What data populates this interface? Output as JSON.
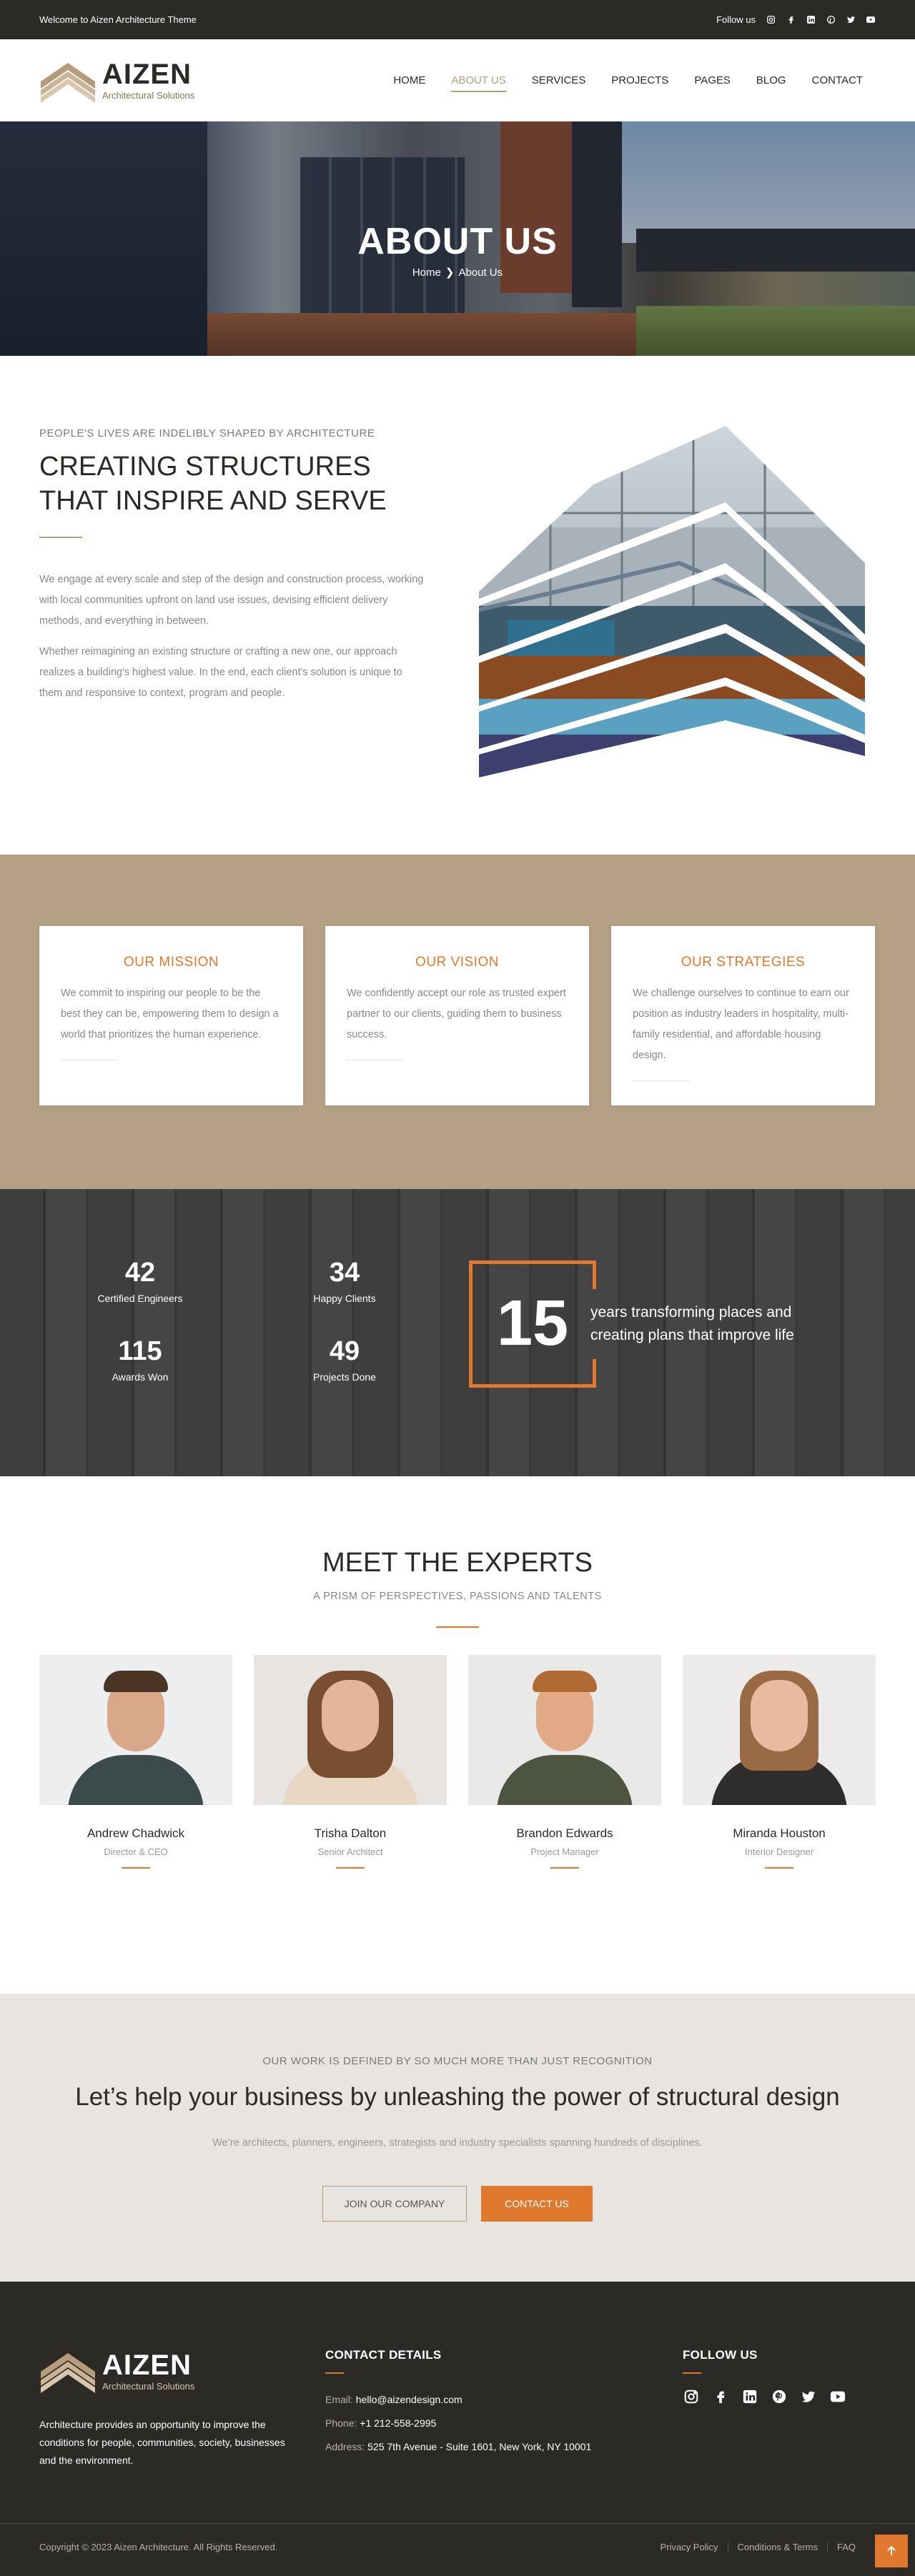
{
  "topbar": {
    "welcome": "Welcome to Aizen Architecture Theme",
    "follow_label": "Follow us",
    "social_icons": [
      "instagram-icon",
      "facebook-icon",
      "linkedin-icon",
      "pinterest-icon",
      "twitter-icon",
      "youtube-icon"
    ]
  },
  "brand": {
    "name": "AIZEN",
    "tagline": "Architectural Solutions",
    "colors": {
      "accent": "#e0792e",
      "tan": "#b59b79",
      "dark": "#2c2a26"
    }
  },
  "nav": {
    "items": [
      "HOME",
      "ABOUT US",
      "SERVICES",
      "PROJECTS",
      "PAGES",
      "BLOG",
      "CONTACT"
    ],
    "active": "ABOUT US"
  },
  "hero": {
    "title": "ABOUT US",
    "breadcrumb": [
      "Home",
      "About Us"
    ]
  },
  "about": {
    "eyebrow": "PEOPLE'S LIVES ARE INDELIBLY SHAPED BY ARCHITECTURE",
    "heading": "CREATING STRUCTURES THAT INSPIRE AND SERVE",
    "paragraphs": [
      "We engage at every scale and step of the design and construction process, working with local communities upfront on land use issues, devising efficient delivery methods, and everything in between.",
      "Whether reimagining an existing structure or crafting a new one, our approach realizes a building's highest value. In the end, each client's solution is unique to them and responsive to context, program and people."
    ]
  },
  "cards": [
    {
      "title": "OUR MISSION",
      "text": "We commit to inspiring our people to be the best they can be, empowering them to design a world that prioritizes the human experience."
    },
    {
      "title": "OUR VISION",
      "text": "We confidently accept our role as trusted expert partner to our clients, guiding them to business success."
    },
    {
      "title": "OUR STRATEGIES",
      "text": "We challenge ourselves to continue to earn our position as industry leaders in hospitality, multi-family residential, and affordable housing design."
    }
  ],
  "stats": {
    "items": [
      {
        "num": "42",
        "label": "Certified Engineers"
      },
      {
        "num": "34",
        "label": "Happy Clients"
      },
      {
        "num": "115",
        "label": "Awards Won"
      },
      {
        "num": "49",
        "label": "Projects Done"
      }
    ],
    "years_num": "15",
    "years_text": "years transforming places and creating plans that improve life"
  },
  "team": {
    "heading": "MEET THE EXPERTS",
    "subheading": "A PRISM OF PERSPECTIVES, PASSIONS AND TALENTS",
    "members": [
      {
        "name": "Andrew Chadwick",
        "role": "Director & CEO"
      },
      {
        "name": "Trisha Dalton",
        "role": "Senior Architect"
      },
      {
        "name": "Brandon Edwards",
        "role": "Project Manager"
      },
      {
        "name": "Miranda Houston",
        "role": "Interior Designer"
      }
    ]
  },
  "cta": {
    "eyebrow": "OUR WORK IS DEFINED BY SO MUCH MORE THAN JUST RECOGNITION",
    "heading": "Let’s help your business by unleashing the power of structural design",
    "text": "We’re architects, planners, engineers, strategists and industry specialists spanning hundreds of disciplines.",
    "btn_outline": "JOIN OUR COMPANY",
    "btn_fill": "CONTACT US"
  },
  "footer": {
    "blurb": "Architecture provides an opportunity to improve the conditions for people, communities, society, businesses and the environment.",
    "contact_title": "CONTACT DETAILS",
    "email_label": "Email:",
    "email": "hello@aizendesign.com",
    "phone_label": "Phone:",
    "phone": "+1 212-558-2995",
    "address_label": "Address:",
    "address": "525 7th Avenue - Suite 1601, New York, NY 10001",
    "follow_title": "FOLLOW US",
    "social_icons": [
      "instagram-icon",
      "facebook-icon",
      "linkedin-icon",
      "pinterest-icon",
      "twitter-icon",
      "youtube-icon"
    ],
    "copyright": "Copyright © 2023 Aizen Architecture. All Rights Reserved.",
    "links": [
      "Privacy Policy",
      "Conditions & Terms",
      "FAQ"
    ]
  }
}
